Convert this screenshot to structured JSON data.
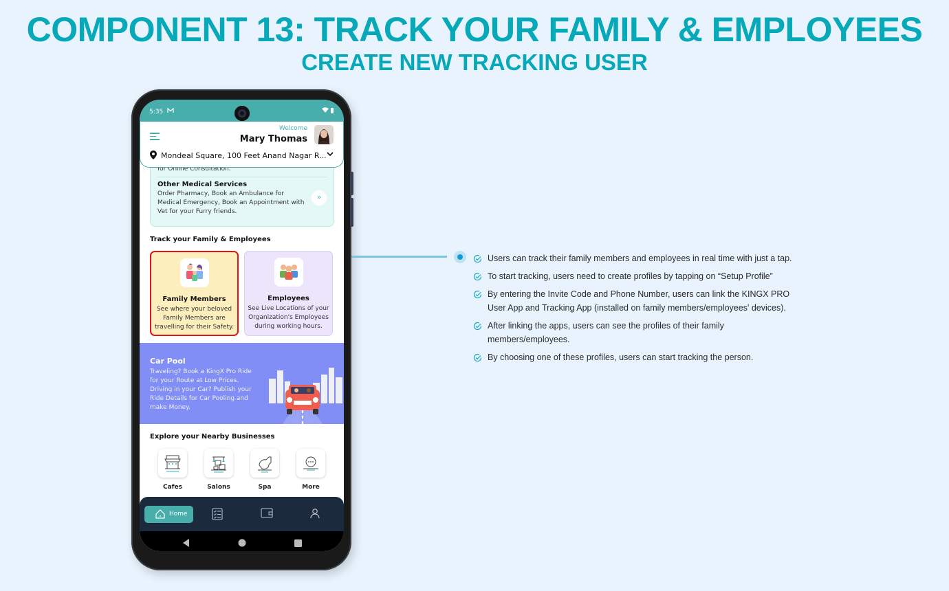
{
  "page": {
    "title": "COMPONENT 13: TRACK YOUR FAMILY & EMPLOYEES",
    "subtitle": "CREATE NEW TRACKING USER"
  },
  "phone": {
    "status_bar": {
      "time": "5:35",
      "notification_icon": "gmail-icon",
      "right_icons": "wifi-battery"
    },
    "header": {
      "welcome": "Welcome",
      "user_name": "Mary Thomas",
      "address": "Mondeal Square, 100 Feet Anand Nagar R..."
    },
    "medical_card": {
      "prev_text": "for Online Consultation.",
      "title": "Other Medical Services",
      "description": "Order Pharmacy, Book an Ambulance for Medical Emergency, Book an Appointment with Vet for your Furry friends."
    },
    "tracking": {
      "section_title": "Track your Family & Employees",
      "cards": [
        {
          "title": "Family Members",
          "description": "See where your beloved Family Members are travelling for their Safety.",
          "selected": true
        },
        {
          "title": "Employees",
          "description": "See Live Locations of your Organization's Employees during working hours.",
          "selected": false
        }
      ]
    },
    "carpool": {
      "title": "Car Pool",
      "description": "Traveling? Book a KingX Pro Ride for your Route at Low Prices. Driving in your Car? Publish your Ride Details for Car Pooling and make Money."
    },
    "nearby": {
      "section_title": "Explore your Nearby Businesses",
      "items": [
        {
          "label": "Cafes",
          "icon": "cafe-icon"
        },
        {
          "label": "Salons",
          "icon": "salon-icon"
        },
        {
          "label": "Spa",
          "icon": "spa-icon"
        },
        {
          "label": "More",
          "icon": "more-icon"
        }
      ]
    },
    "bottom_nav": {
      "items": [
        {
          "label": "Home",
          "icon": "home-icon",
          "active": true
        },
        {
          "label": "",
          "icon": "checklist-icon",
          "active": false
        },
        {
          "label": "",
          "icon": "wallet-icon",
          "active": false
        },
        {
          "label": "",
          "icon": "profile-icon",
          "active": false
        }
      ]
    }
  },
  "features": [
    "Users can track their family members and employees in real time with just a tap.",
    "To start tracking, users need to create profiles by tapping on “Setup Profile”",
    "By entering the Invite Code and Phone Number, users can link the KINGX PRO User App and Tracking App (installed on family members/employees' devices).",
    "After linking the apps, users can see the profiles of their family members/employees.",
    "By choosing one of these profiles, users can start tracking the person."
  ],
  "colors": {
    "title": "#07a8b8",
    "app_primary": "#47aeab",
    "nav_bg": "#1b2a3c",
    "carpool_bg": "#818ef5",
    "family_card_bg": "#fdefbd",
    "employee_card_bg": "#ece5fc",
    "selected_border": "#e01414",
    "background": "#e8f3fd"
  }
}
